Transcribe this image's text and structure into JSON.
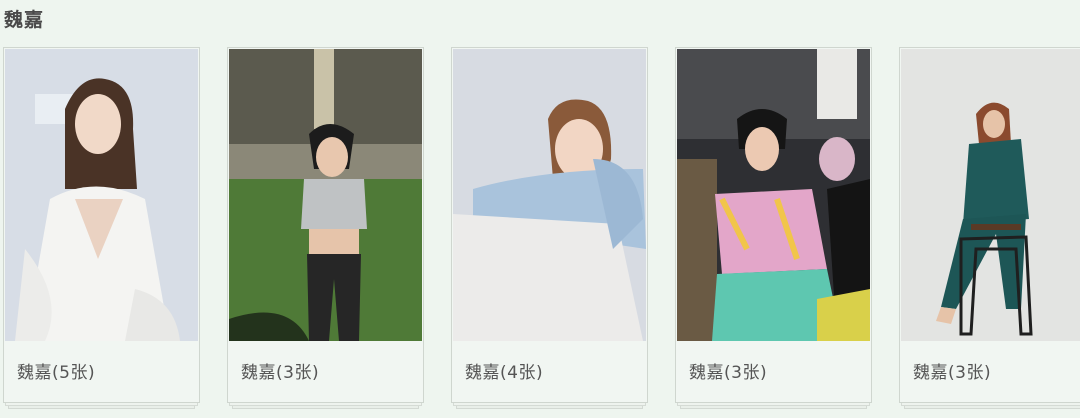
{
  "section": {
    "title": "魏嘉"
  },
  "albums": [
    {
      "caption": "魏嘉(5张)"
    },
    {
      "caption": "魏嘉(3张)"
    },
    {
      "caption": "魏嘉(4张)"
    },
    {
      "caption": "魏嘉(3张)"
    },
    {
      "caption": "魏嘉(3张)"
    }
  ]
}
